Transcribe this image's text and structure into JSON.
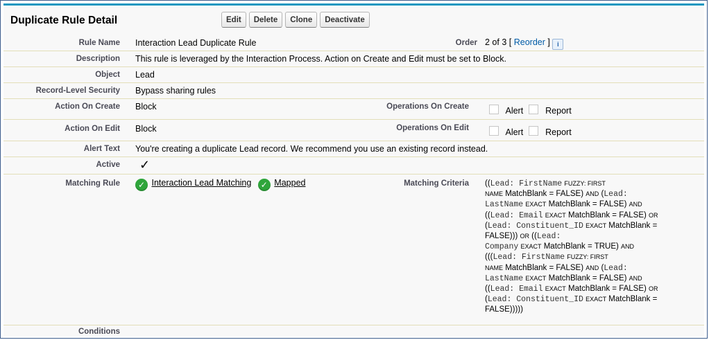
{
  "header": {
    "title": "Duplicate Rule Detail",
    "buttons": [
      "Edit",
      "Delete",
      "Clone",
      "Deactivate"
    ]
  },
  "rule_name": {
    "label": "Rule Name",
    "value": "Interaction Lead Duplicate Rule"
  },
  "order": {
    "label": "Order",
    "value": "2 of 3",
    "bracket_open": "[",
    "reorder_link": "Reorder",
    "bracket_close": "]",
    "info_icon": "i"
  },
  "description": {
    "label": "Description",
    "value": "This rule is leveraged by the Interaction Process. Action on Create and Edit must be set to Block."
  },
  "object": {
    "label": "Object",
    "value": "Lead"
  },
  "record_level_security": {
    "label": "Record-Level Security",
    "value": "Bypass sharing rules"
  },
  "action_on_create": {
    "label": "Action On Create",
    "value": "Block",
    "ops_label": "Operations On Create",
    "alert": "Alert",
    "report": "Report"
  },
  "action_on_edit": {
    "label": "Action On Edit",
    "value": "Block",
    "ops_label": "Operations On Edit",
    "alert": "Alert",
    "report": "Report"
  },
  "alert_text": {
    "label": "Alert Text",
    "value": "You're creating a duplicate Lead record. We recommend you use an existing record instead."
  },
  "active": {
    "label": "Active",
    "checkmark": "✓"
  },
  "matching_rule": {
    "label": "Matching Rule",
    "rule_link": "Interaction Lead Matching",
    "status_link": "Mapped",
    "criteria_label": "Matching Criteria",
    "criteria_lines": [
      "((Lead: FirstName FUZZY: FIRST",
      "NAME MatchBlank = FALSE) AND (Lead:",
      "LastName EXACT MatchBlank = FALSE) AND",
      "((Lead: Email EXACT MatchBlank = FALSE) OR",
      "(Lead: Constituent_ID EXACT MatchBlank =",
      "FALSE))) OR ((Lead:",
      "Company EXACT MatchBlank = TRUE) AND",
      "(((Lead: FirstName FUZZY: FIRST",
      "NAME MatchBlank = FALSE) AND (Lead:",
      "LastName EXACT MatchBlank = FALSE) AND",
      "((Lead: Email EXACT MatchBlank = FALSE) OR",
      "(Lead: Constituent_ID EXACT MatchBlank =",
      "FALSE)))))"
    ]
  },
  "conditions": {
    "label": "Conditions",
    "value": ""
  }
}
